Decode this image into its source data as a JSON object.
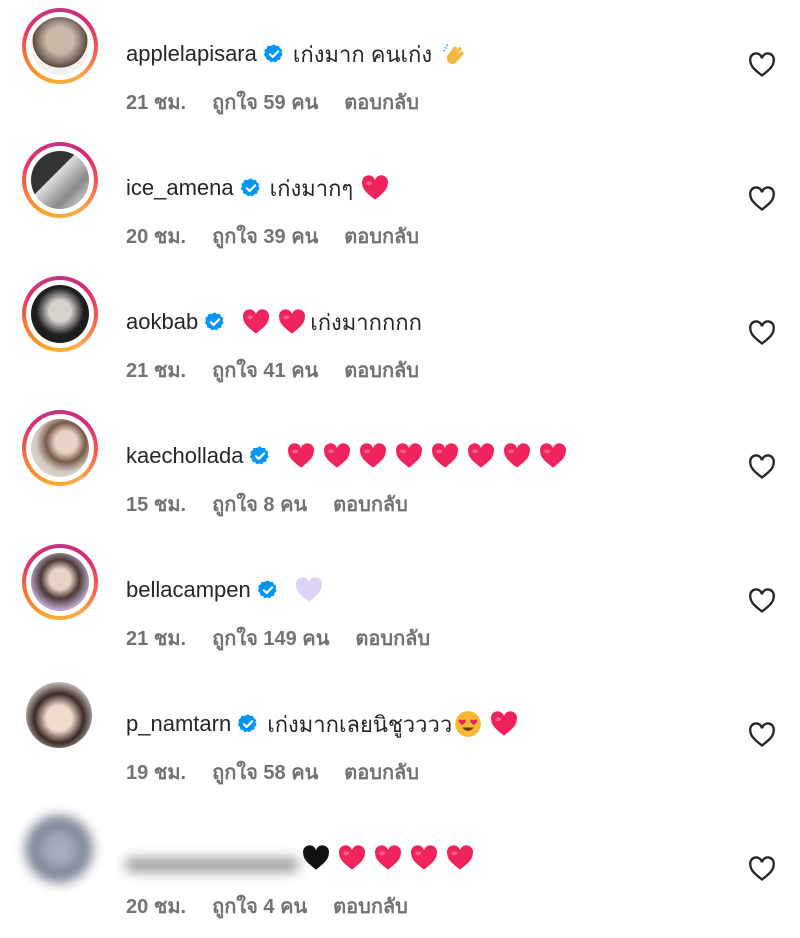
{
  "comments": [
    {
      "username": "applelapisara",
      "text": "เก่งมาก คนเก่ง",
      "emoji": [
        "clap"
      ],
      "time": "21 ชม.",
      "likes": "ถูกใจ 59 คน",
      "reply": "ตอบกลับ",
      "ring": true
    },
    {
      "username": "ice_amena",
      "text": "เก่งมากๆ",
      "emoji": [
        "heart"
      ],
      "time": "20 ชม.",
      "likes": "ถูกใจ 39 คน",
      "reply": "ตอบกลับ",
      "ring": true
    },
    {
      "username": "aokbab",
      "text": "เก่งมากกกก",
      "emoji_before": [
        "heart",
        "heart"
      ],
      "time": "21 ชม.",
      "likes": "ถูกใจ 41 คน",
      "reply": "ตอบกลับ",
      "ring": true
    },
    {
      "username": "kaechollada",
      "text": "",
      "emoji": [
        "heart",
        "heart",
        "heart",
        "heart",
        "heart",
        "heart",
        "heart",
        "heart"
      ],
      "time": "15 ชม.",
      "likes": "ถูกใจ 8 คน",
      "reply": "ตอบกลับ",
      "ring": true
    },
    {
      "username": "bellacampen",
      "text": "",
      "emoji": [
        "light-purple-heart"
      ],
      "time": "21 ชม.",
      "likes": "ถูกใจ 149 คน",
      "reply": "ตอบกลับ",
      "ring": true
    },
    {
      "username": "p_namtarn",
      "text": "เก่งมากเลยนิชูวววว",
      "emoji": [
        "heart-eyes",
        "heart"
      ],
      "time": "19 ชม.",
      "likes": "ถูกใจ 58 คน",
      "reply": "ตอบกลับ",
      "ring": false
    },
    {
      "username": "",
      "text": "",
      "emoji": [
        "black-heart",
        "heart",
        "heart",
        "heart",
        "heart"
      ],
      "time": "20 ชม.",
      "likes": "ถูกใจ 4 คน",
      "reply": "ตอบกลับ",
      "ring": false,
      "blurred": true
    }
  ],
  "colors": {
    "accent_verified": "#0095f6",
    "heart": "#f0245c",
    "text": "#262626",
    "meta": "#737373"
  }
}
